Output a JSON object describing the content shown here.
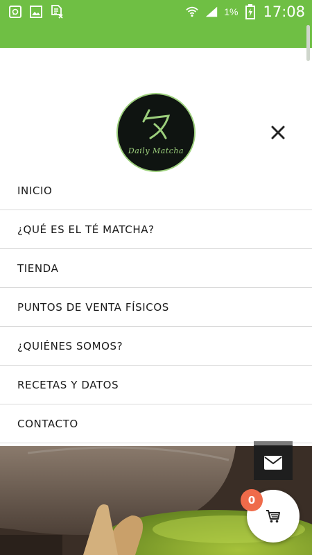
{
  "status_bar": {
    "left_icons": [
      "chat-notification-icon",
      "gallery-icon",
      "document-x-icon"
    ],
    "right_icons": [
      "wifi-icon",
      "signal-icon",
      "battery-charging-icon"
    ],
    "battery_percent": "1%",
    "time": "17:08"
  },
  "logo": {
    "text": "Daily Matcha",
    "icon": "matcha-logo-symbol"
  },
  "close_icon": "close-icon",
  "menu": {
    "items": [
      {
        "label": "INICIO"
      },
      {
        "label": "¿QUÉ ES EL TÉ MATCHA?"
      },
      {
        "label": "TIENDA"
      },
      {
        "label": "PUNTOS DE VENTA FÍSICOS"
      },
      {
        "label": "¿QUIÉNES SOMOS?"
      },
      {
        "label": "RECETAS Y DATOS"
      },
      {
        "label": "CONTACTO"
      }
    ]
  },
  "email_button": {
    "icon": "envelope-icon"
  },
  "cart": {
    "icon": "cart-icon",
    "count": "0"
  },
  "colors": {
    "brand_green": "#6fbf44",
    "logo_green": "#9ccf7c",
    "badge_orange": "#ef6b4a"
  }
}
